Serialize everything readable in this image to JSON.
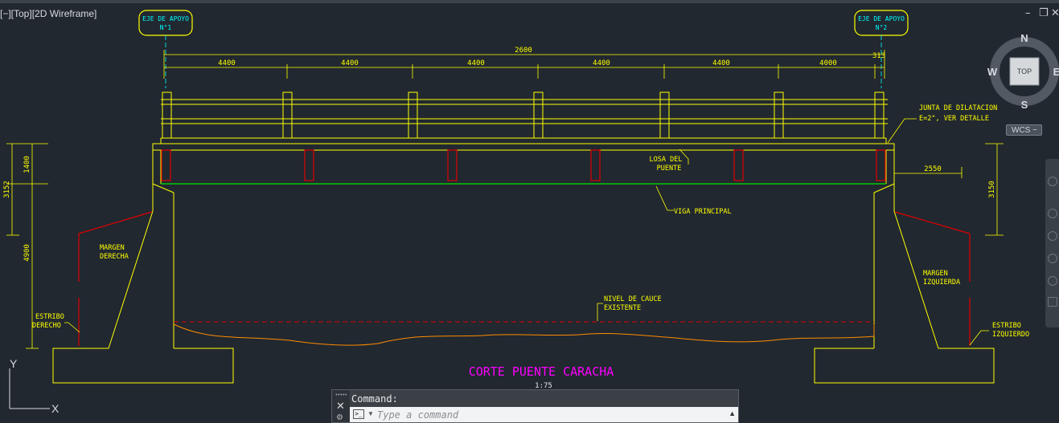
{
  "viewport": {
    "label": "[−][Top][2D Wireframe]",
    "window_buttons": {
      "minimize": "–",
      "restore": "❐",
      "close": "✕"
    }
  },
  "drawing": {
    "axis_labels": {
      "left_l1": "EJE DE APOYO",
      "left_l2": "N°1",
      "right_l1": "EJE DE APOYO",
      "right_l2": "N°2"
    },
    "dimensions": {
      "total": "2600",
      "spans": [
        "4400",
        "4400",
        "4400",
        "4400",
        "4400",
        "4000",
        "313"
      ],
      "left_total": "3152",
      "left_upper": "1400",
      "left_lower": "4900",
      "right_vertical": "3150",
      "right_horizontal": "2550"
    },
    "labels": {
      "junta_l1": "JUNTA DE DILATACION",
      "junta_l2": "E=2\", VER DETALLE",
      "losa_l1": "LOSA DEL",
      "losa_l2": "PUENTE",
      "viga": "VIGA PRINCIPAL",
      "margen_der_l1": "MARGEN",
      "margen_der_l2": "DERECHA",
      "margen_izq_l1": "MARGEN",
      "margen_izq_l2": "IZQUIERDA",
      "nivel_l1": "NIVEL DE CAUCE",
      "nivel_l2": "EXISTENTE",
      "estribo_der_l1": "ESTRIBO",
      "estribo_der_l2": "DERECHO",
      "estribo_izq_l1": "ESTRIBO",
      "estribo_izq_l2": "IZQUIERDO",
      "title": "CORTE PUENTE CARACHA",
      "scale": "1:75"
    },
    "colors": {
      "background": "#212830",
      "structure": "#ffff00",
      "beam_line": "#00e600",
      "section_cut": "#e00000",
      "terrain": "#ff8c00",
      "title": "#ff00ff",
      "axis_tag": "#00ffff"
    }
  },
  "viewcube": {
    "north": "N",
    "south": "S",
    "east": "E",
    "west": "W",
    "face": "TOP",
    "wcs": "WCS −"
  },
  "ucs": {
    "y": "Y",
    "x": "X"
  },
  "command": {
    "history": "Command:",
    "placeholder": "Type a command",
    "close_icon": "close-icon",
    "prompt_icon": ">_"
  }
}
